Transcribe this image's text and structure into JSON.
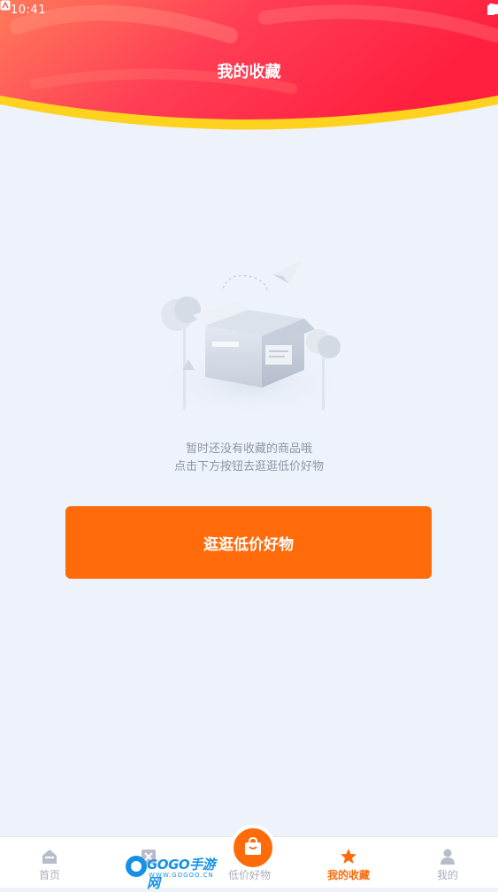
{
  "status_bar": {
    "time": "10:41"
  },
  "header": {
    "title": "我的收藏"
  },
  "empty_state": {
    "line1": "暂时还没有收藏的商品哦",
    "line2": "点击下方按钮去逛逛低价好物",
    "button_label": "逛逛低价好物"
  },
  "bottom_nav": {
    "items": [
      {
        "label": "首页",
        "icon": "home-icon"
      },
      {
        "label": "",
        "icon": "category-icon"
      },
      {
        "label": "低价好物",
        "icon": "shopping-bag-icon"
      },
      {
        "label": "我的收藏",
        "icon": "star-icon",
        "active": true
      },
      {
        "label": "我的",
        "icon": "user-icon"
      }
    ]
  },
  "watermark": {
    "brand": "GOGO手游网",
    "sub": "WWW.GOGOO.CN"
  },
  "colors": {
    "accent": "#ff6a0a",
    "header_red": "#ff2d4a",
    "header_yellow": "#ffd21f",
    "background": "#eef3fb",
    "inactive": "#a9b0bd"
  }
}
